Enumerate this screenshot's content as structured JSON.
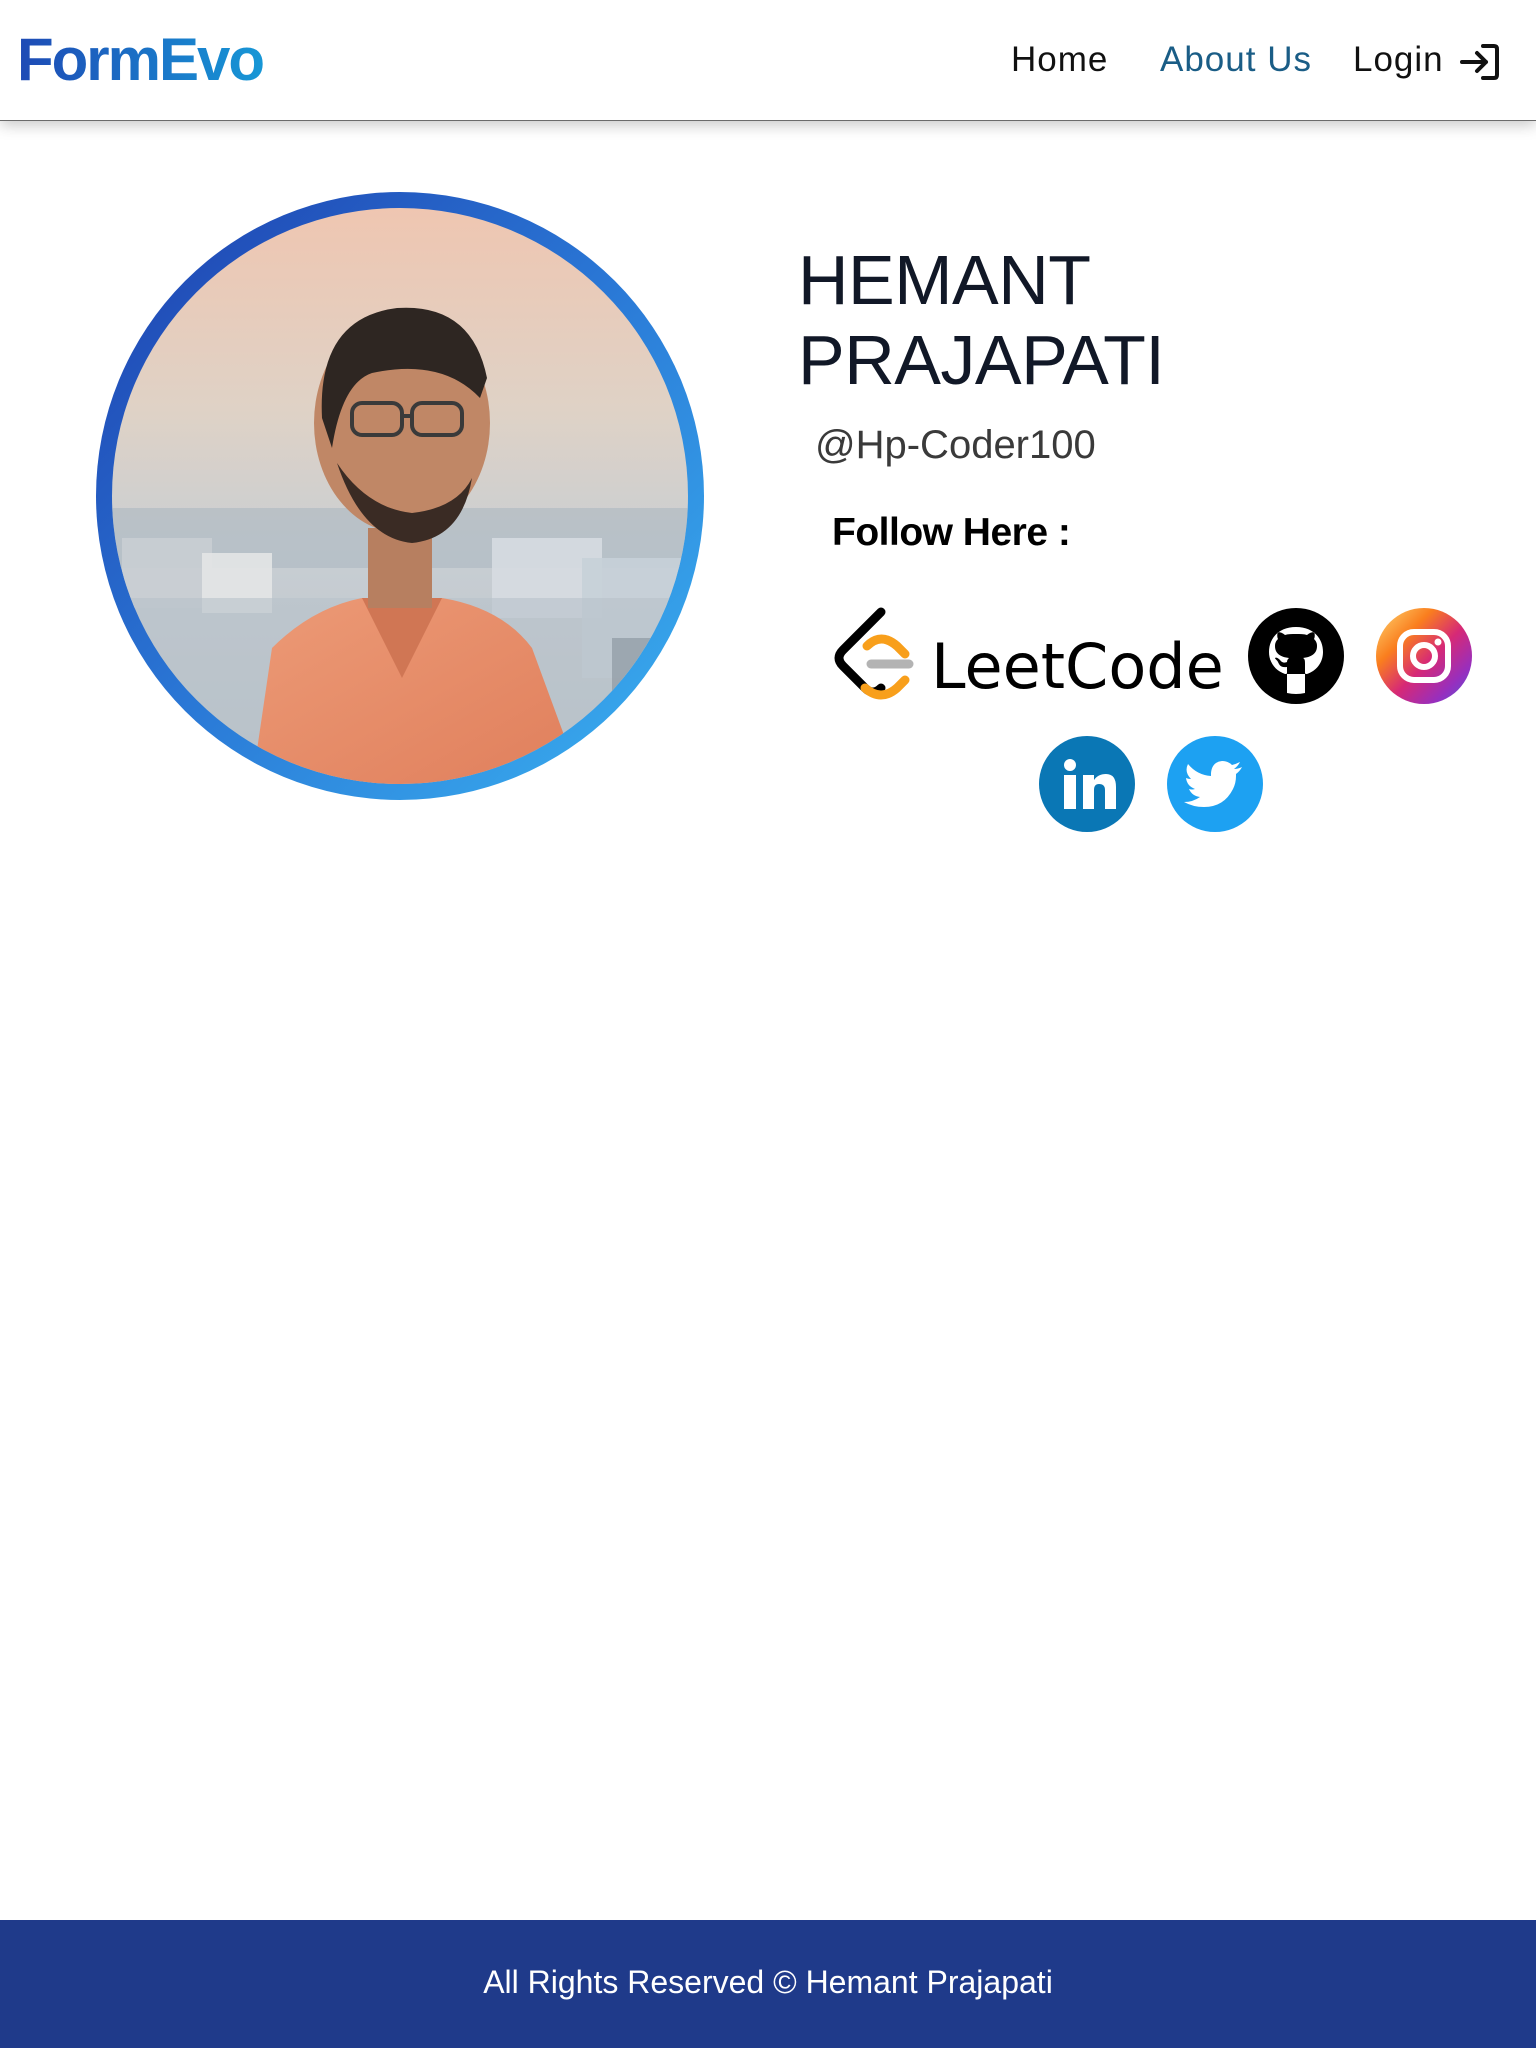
{
  "nav": {
    "brand": "FormEvo",
    "links": [
      "Home",
      "About Us",
      "Login"
    ],
    "active_link": "About Us",
    "login_icon": "login-icon",
    "brand_colors": [
      "#1e4ab5",
      "#1797d6"
    ]
  },
  "profile": {
    "name": "HEMANT PRAJAPATI",
    "handle": "@Hp-Coder100",
    "follow_label": "Follow Here :",
    "avatar": "profile-photo"
  },
  "socials": [
    {
      "name": "LeetCode",
      "icon": "leetcode-logo"
    },
    {
      "name": "GitHub",
      "icon": "github-icon"
    },
    {
      "name": "Instagram",
      "icon": "instagram-icon"
    },
    {
      "name": "LinkedIn",
      "icon": "linkedin-icon"
    },
    {
      "name": "Twitter",
      "icon": "twitter-icon"
    }
  ],
  "footer": {
    "text": "All Rights Reserved © Hemant Prajapati",
    "background": "#1f3a8a"
  }
}
